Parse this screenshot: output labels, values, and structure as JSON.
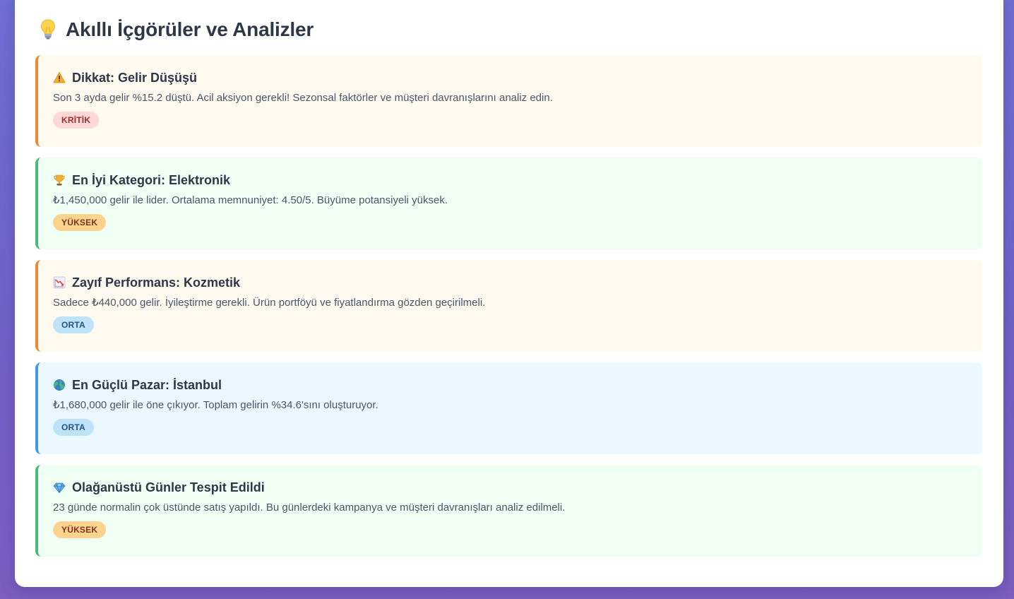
{
  "header": {
    "icon": "lightbulb-icon",
    "title": "Akıllı İçgörüler ve Analizler"
  },
  "insights": [
    {
      "variant": "warn",
      "icon": "warning-icon",
      "title": "Dikkat: Gelir Düşüşü",
      "description": "Son 3 ayda gelir %15.2 düştü. Acil aksiyon gerekli! Sezonsal faktörler ve müşteri davranışlarını analiz edin.",
      "badge": "KRİTİK",
      "badge_level": "critical"
    },
    {
      "variant": "good",
      "icon": "trophy-icon",
      "title": "En İyi Kategori: Elektronik",
      "description": "₺1,450,000 gelir ile lider. Ortalama memnuniyet: 4.50/5. Büyüme potansiyeli yüksek.",
      "badge": "YÜKSEK",
      "badge_level": "high"
    },
    {
      "variant": "warn",
      "icon": "chart-decreasing-icon",
      "title": "Zayıf Performans: Kozmetik",
      "description": "Sadece ₺440,000 gelir. İyileştirme gerekli. Ürün portföyü ve fiyatlandırma gözden geçirilmeli.",
      "badge": "ORTA",
      "badge_level": "medium"
    },
    {
      "variant": "info",
      "icon": "globe-icon",
      "title": "En Güçlü Pazar: İstanbul",
      "description": "₺1,680,000 gelir ile öne çıkıyor. Toplam gelirin %34.6'sını oluşturuyor.",
      "badge": "ORTA",
      "badge_level": "medium"
    },
    {
      "variant": "good",
      "icon": "gem-icon",
      "title": "Olağanüstü Günler Tespit Edildi",
      "description": "23 günde normalin çok üstünde satış yapıldı. Bu günlerdeki kampanya ve müşteri davranışları analiz edilmeli.",
      "badge": "YÜKSEK",
      "badge_level": "high"
    }
  ],
  "colors": {
    "warn_border": "#ed8936",
    "good_border": "#48bb78",
    "info_border": "#4299e1",
    "badge_critical": "#fed7d7",
    "badge_high": "#fbd38d",
    "badge_medium": "#bee3f8"
  }
}
